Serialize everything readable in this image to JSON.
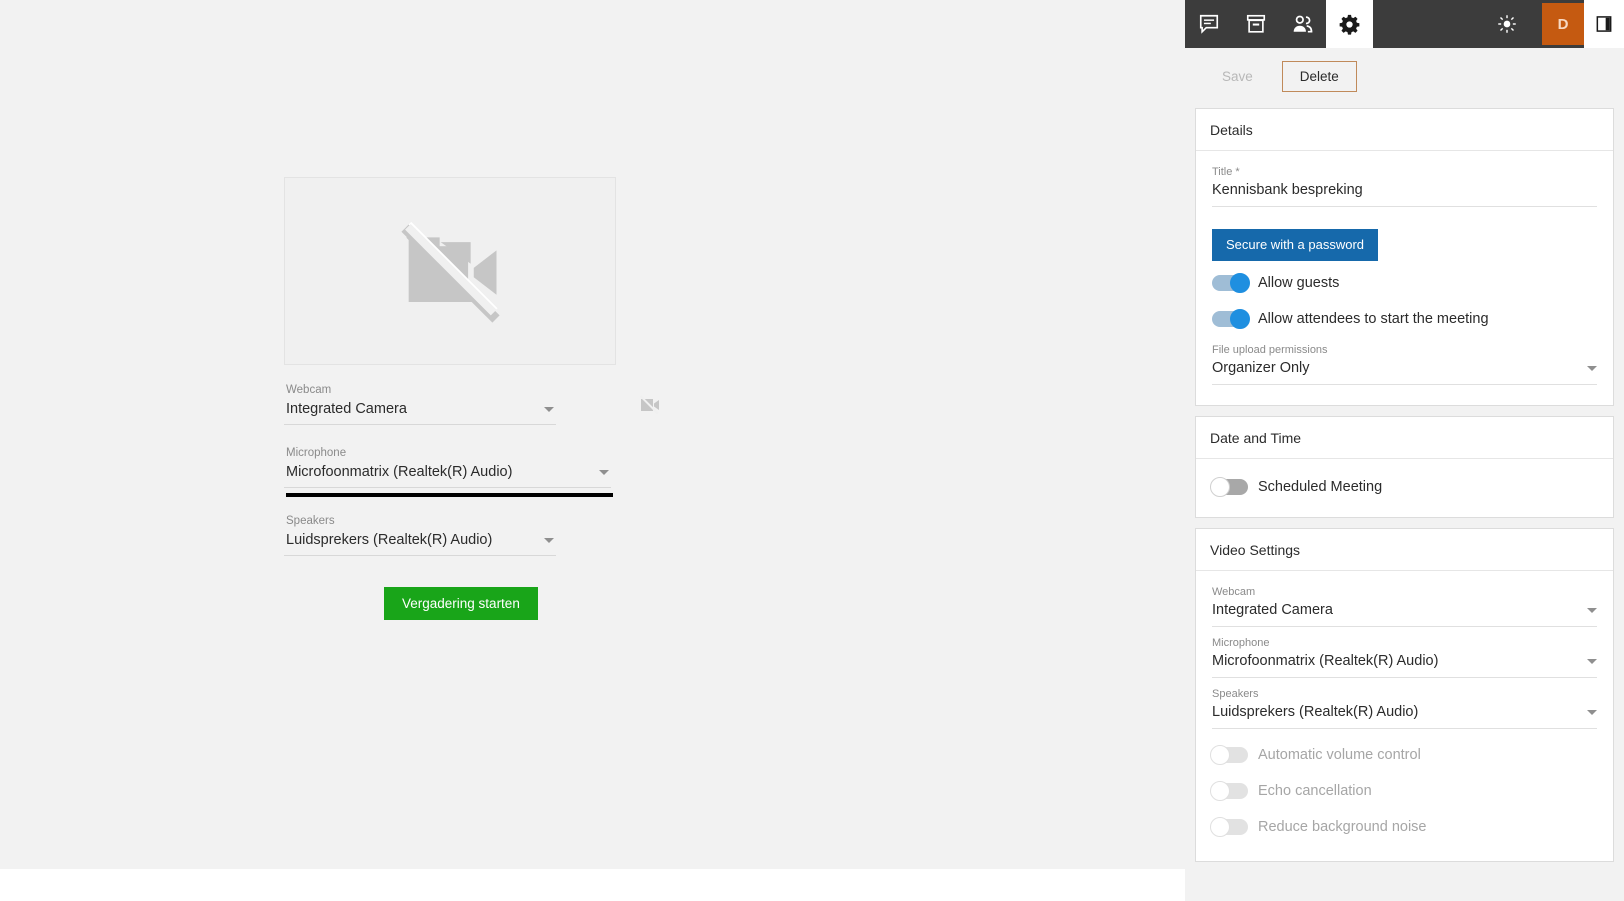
{
  "toolbar": {
    "left_icons": [
      {
        "name": "chat-icon",
        "label": "Chat"
      },
      {
        "name": "archive-icon",
        "label": "Archive"
      },
      {
        "name": "people-icon",
        "label": "Participants"
      }
    ],
    "settings_icon": {
      "name": "gear-icon",
      "label": "Settings",
      "active": true
    },
    "brightness_icon": {
      "name": "brightness-icon",
      "label": "Theme"
    },
    "avatar_initial": "D",
    "panel_toggle_icon": {
      "name": "panel-toggle-icon",
      "label": "Toggle side panel"
    },
    "colors": {
      "toolbar_bg": "#3c3c3c",
      "avatar_bg": "#c55a11",
      "active_bg": "#ffffff"
    }
  },
  "actions": {
    "save_label": "Save",
    "delete_label": "Delete",
    "save_disabled": true
  },
  "details_card": {
    "header": "Details",
    "title_label": "Title *",
    "title_value": "Kennisbank bespreking",
    "secure_button_label": "Secure with a password",
    "secure_button_color": "#1669ab",
    "toggles": [
      {
        "label": "Allow guests",
        "on": true
      },
      {
        "label": "Allow attendees to start the meeting",
        "on": true
      }
    ],
    "file_upload_label": "File upload permissions",
    "file_upload_value": "Organizer Only"
  },
  "date_time_card": {
    "header": "Date and Time",
    "scheduled_toggle": {
      "label": "Scheduled Meeting",
      "on": false
    }
  },
  "video_settings_card": {
    "header": "Video Settings",
    "webcam_label": "Webcam",
    "webcam_value": "Integrated Camera",
    "microphone_label": "Microphone",
    "microphone_value": "Microfoonmatrix (Realtek(R) Audio)",
    "speakers_label": "Speakers",
    "speakers_value": "Luidsprekers (Realtek(R) Audio)",
    "toggles": [
      {
        "label": "Automatic volume control",
        "on": false,
        "disabled": true
      },
      {
        "label": "Echo cancellation",
        "on": false,
        "disabled": true
      },
      {
        "label": "Reduce background noise",
        "on": false,
        "disabled": true
      }
    ]
  },
  "main": {
    "preview_icon": "videocam-off-icon",
    "webcam_label": "Webcam",
    "webcam_value": "Integrated Camera",
    "webcam_status_icon": "videocam-off-icon",
    "microphone_label": "Microphone",
    "microphone_value": "Microfoonmatrix (Realtek(R) Audio)",
    "speakers_label": "Speakers",
    "speakers_value": "Luidsprekers (Realtek(R) Audio)",
    "start_button_label": "Vergadering starten",
    "start_button_color": "#19a519"
  }
}
